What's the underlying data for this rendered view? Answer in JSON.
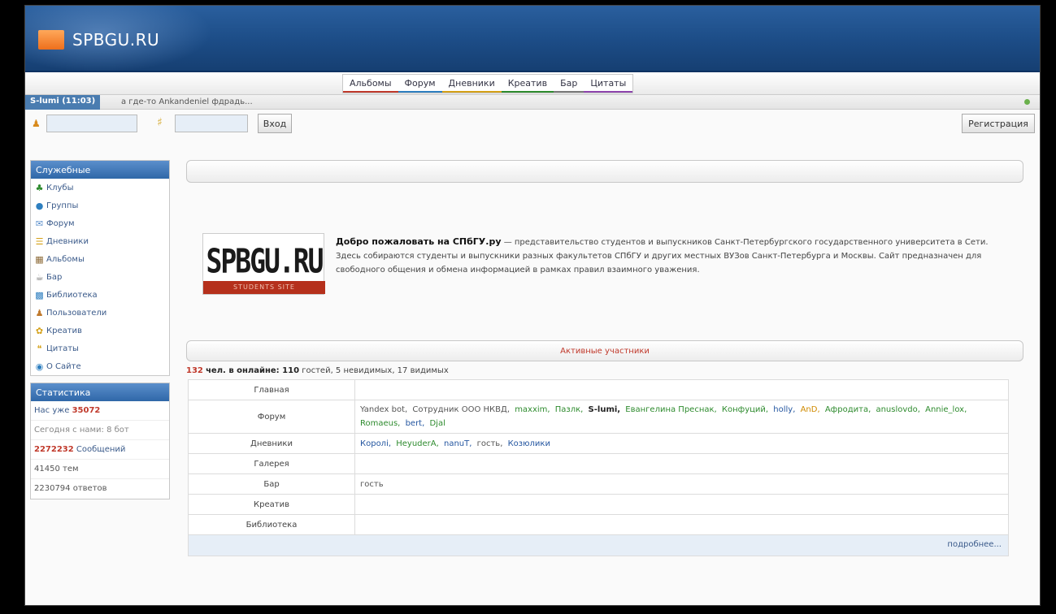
{
  "site": {
    "name": "SPBGU.RU"
  },
  "nav": {
    "tabs": [
      {
        "label": "Альбомы",
        "color": "#c0392b"
      },
      {
        "label": "Форум",
        "color": "#2e7fc0"
      },
      {
        "label": "Дневники",
        "color": "#d4a017"
      },
      {
        "label": "Креатив",
        "color": "#2e8b2e"
      },
      {
        "label": "Бар",
        "color": "#7a7a7a"
      },
      {
        "label": "Цитаты",
        "color": "#8e44ad"
      }
    ]
  },
  "userbar": {
    "user": "S-lumi (11:03)",
    "status": "а где-то Ankandeniel фдрадь..."
  },
  "login": {
    "submit_label": "Вход",
    "register_label": "Регистрация"
  },
  "sidebar": {
    "nav_title": "Служебные",
    "items": [
      {
        "label": "Клубы",
        "icon": "clubs-icon"
      },
      {
        "label": "Группы",
        "icon": "groups-icon"
      },
      {
        "label": "Форум",
        "icon": "forum-icon"
      },
      {
        "label": "Дневники",
        "icon": "diaries-icon"
      },
      {
        "label": "Альбомы",
        "icon": "albums-icon"
      },
      {
        "label": "Бар",
        "icon": "bar-icon"
      },
      {
        "label": "Библиотека",
        "icon": "library-icon"
      },
      {
        "label": "Пользователи",
        "icon": "users-icon"
      },
      {
        "label": "Креатив",
        "icon": "creative-icon"
      },
      {
        "label": "Цитаты",
        "icon": "quotes-icon"
      },
      {
        "label": "О Сайте",
        "icon": "about-icon"
      }
    ],
    "stats_title": "Статистика",
    "stats": {
      "users_prefix": "Нас уже",
      "users_count": "35072",
      "today_line": "Сегодня с нами: 8 бот",
      "messages_count": "2272232",
      "messages_label": "Сообщений",
      "threads_line": "41450 тем",
      "answers_line": "2230794 ответов"
    }
  },
  "welcome": {
    "logo_text": "SPBGU.RU",
    "logo_sub": "STUDENTS SITE",
    "title": "Добро пожаловать на СПбГУ.ру",
    "text": " — представительство студентов и выпускников Санкт-Петербургского государственного университета в Сети. Здесь собираются студенты и выпускники разных факультетов СПбГУ и других местных ВУЗов Санкт-Петербурга и Москвы. Сайт предназначен для свободного общения и обмена информацией в рамках правил взаимного уважения."
  },
  "active": {
    "title": "Активные участники",
    "count": "132",
    "summary_bold": "чел. в онлайне: 110",
    "summary_rest": "гостей, 5 невидимых, 17 видимых",
    "rows": [
      {
        "section": "Главная",
        "users": []
      },
      {
        "section": "Форум",
        "users": [
          {
            "name": "Yandex bot,",
            "c": "u-gr"
          },
          {
            "name": "Сотрудник ООО НКВД,",
            "c": "u-gr"
          },
          {
            "name": "maxxim,",
            "c": "u-g"
          },
          {
            "name": "Пазлк,",
            "c": "u-g"
          },
          {
            "name": "S-lumi,",
            "c": "u-k"
          },
          {
            "name": "Евангелина Преснак,",
            "c": "u-g"
          },
          {
            "name": "Конфуций,",
            "c": "u-g"
          },
          {
            "name": "holly,",
            "c": "u-b"
          },
          {
            "name": "AnD,",
            "c": "u-o"
          },
          {
            "name": "Афродита,",
            "c": "u-g"
          },
          {
            "name": "anuslovdo,",
            "c": "u-g"
          },
          {
            "name": "Annie_lox,",
            "c": "u-g"
          },
          {
            "name": "Romaeus,",
            "c": "u-g"
          },
          {
            "name": "bert,",
            "c": "u-b"
          },
          {
            "name": "Djal",
            "c": "u-g"
          }
        ]
      },
      {
        "section": "Дневники",
        "users": [
          {
            "name": "Королі,",
            "c": "u-b"
          },
          {
            "name": "HeyuderA,",
            "c": "u-g"
          },
          {
            "name": "nanuT,",
            "c": "u-b"
          },
          {
            "name": "гость,",
            "c": "u-gr"
          },
          {
            "name": "Козюлики",
            "c": "u-b"
          }
        ]
      },
      {
        "section": "Галерея",
        "users": []
      },
      {
        "section": "Бар",
        "users": [
          {
            "name": "гость",
            "c": "u-gr"
          }
        ]
      },
      {
        "section": "Креатив",
        "users": []
      },
      {
        "section": "Библиотека",
        "users": []
      }
    ],
    "more_label": "подробнее..."
  }
}
